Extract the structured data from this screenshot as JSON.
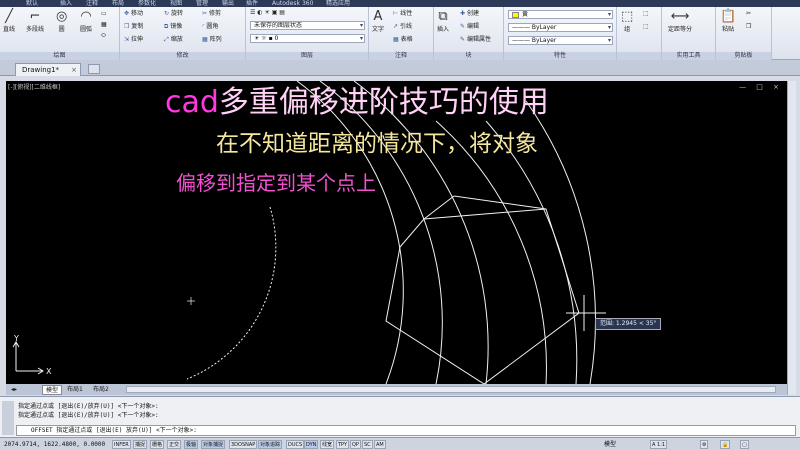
{
  "ribbon_tabs": [
    "默认",
    "插入",
    "注释",
    "布局",
    "参数化",
    "视图",
    "管理",
    "输出",
    "插件",
    "Autodesk 360",
    "精选应用"
  ],
  "ribbon": {
    "draw": {
      "title": "绘图",
      "line": "直线",
      "polyline": "多段线",
      "circle": "圆",
      "arc": "圆弧"
    },
    "modify": {
      "title": "修改",
      "move": "移动",
      "rotate": "旋转",
      "trim": "修剪",
      "copy": "复制",
      "mirror": "镜像",
      "fillet": "圆角",
      "stretch": "拉伸",
      "scale": "缩放",
      "array": "阵列"
    },
    "layers": {
      "title": "图层",
      "state": "未保存的图层状态"
    },
    "annotation": {
      "title": "注释",
      "text": "文字",
      "linear": "线性",
      "leader": "引线",
      "table": "表格"
    },
    "block": {
      "title": "块",
      "insert": "插入",
      "create": "创建",
      "edit": "编辑",
      "edit_attr": "编辑属性"
    },
    "properties": {
      "title": "特性",
      "color": "黄",
      "linetype": "ByLayer",
      "lineweight": "ByLayer"
    },
    "groups": {
      "group": "组"
    },
    "utilities": {
      "title": "实用工具",
      "measure": "测量",
      "divide": "定距等分"
    },
    "clipboard": {
      "title": "剪贴板",
      "paste": "粘贴"
    }
  },
  "doc_tab": "Drawing1*",
  "viewport_label": "[-][俯视][二维线框]",
  "overlay": {
    "title_cad": "cad",
    "title_rest": "多重偏移进阶技巧的使用",
    "line2": "在不知道距离的情况下，将对象",
    "line3": "偏移到指定到某个点上"
  },
  "coord_tip": "范围: 1.2945 < 35°",
  "ucs": {
    "x": "X",
    "y": "Y"
  },
  "layout_tabs": [
    "模型",
    "布局1",
    "布局2"
  ],
  "command": {
    "history": [
      "指定通过点或 [退出(E)/放弃(U)] <下一个对象>:",
      "指定通过点或 [退出(E)/放弃(U)] <下一个对象>:"
    ],
    "current": "OFFSET 指定通过点或 [退出(E) 放弃(U)] <下一个对象>:"
  },
  "status": {
    "coords": "2074.9714, 1622.4800, 0.0000",
    "toggles": [
      "INFER",
      "捕捉",
      "栅格",
      "正交",
      "极轴",
      "对象捕捉",
      "3DOSNAP",
      "对象追踪",
      "DUCS",
      "DYN",
      "线宽",
      "TPY",
      "QP",
      "SC",
      "AM"
    ],
    "model": "模型",
    "scale": "A 1:1"
  },
  "colors": {
    "canvas": "#000000",
    "geometry": "#f2f2ee",
    "cad_text": "#ff39e0"
  }
}
